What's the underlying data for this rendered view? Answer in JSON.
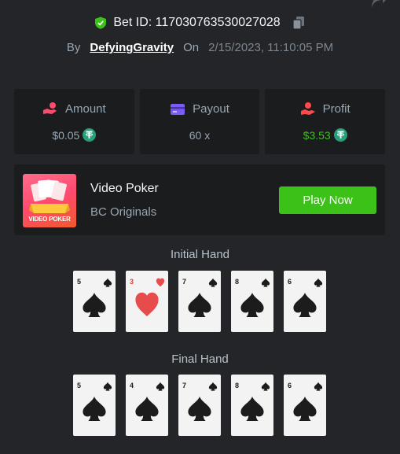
{
  "bet": {
    "id_label": "Bet ID: 117030763530027028",
    "by_label": "By",
    "username": "DefyingGravity",
    "on_label": "On",
    "date": "2/15/2023, 11:10:05 PM"
  },
  "stats": [
    {
      "title": "Amount",
      "value": "$0.05",
      "icon": "hand-coin-icon",
      "icon_color": "#ff4a6e"
    },
    {
      "title": "Payout",
      "value": "60 x",
      "icon": "wallet-card-icon",
      "icon_color": "#7b5cf5"
    },
    {
      "title": "Profit",
      "value": "$3.53",
      "icon": "hand-money-icon",
      "icon_color": "#ff4a4a"
    }
  ],
  "game": {
    "name": "Video Poker",
    "provider": "BC Originals",
    "thumb_label": "VIDEO POKER",
    "play_label": "Play Now"
  },
  "initial_hand": {
    "title": "Initial Hand",
    "cards": [
      {
        "rank": "5",
        "suit": "spade"
      },
      {
        "rank": "3",
        "suit": "heart"
      },
      {
        "rank": "7",
        "suit": "spade"
      },
      {
        "rank": "8",
        "suit": "spade"
      },
      {
        "rank": "6",
        "suit": "spade"
      }
    ]
  },
  "final_hand": {
    "title": "Final Hand",
    "cards": [
      {
        "rank": "5",
        "suit": "spade"
      },
      {
        "rank": "4",
        "suit": "spade"
      },
      {
        "rank": "7",
        "suit": "spade"
      },
      {
        "rank": "8",
        "suit": "spade"
      },
      {
        "rank": "6",
        "suit": "spade"
      }
    ]
  },
  "colors": {
    "accent_green": "#3bc117",
    "background": "#232528",
    "panel": "#1b1c1e",
    "muted_text": "#98a7b5",
    "usdt": "#26a17b"
  }
}
